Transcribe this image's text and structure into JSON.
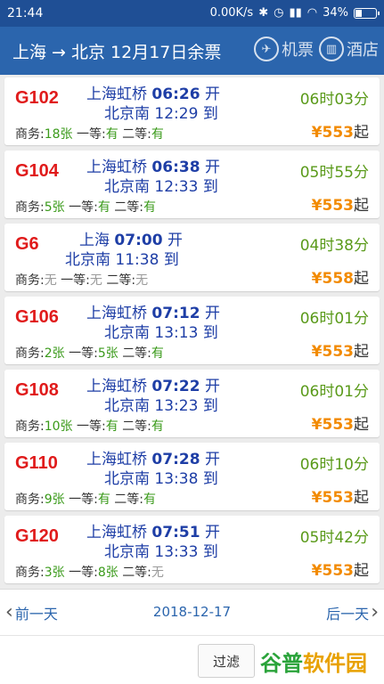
{
  "status_bar": {
    "time": "21:44",
    "network_speed": "0.00K/s",
    "battery_percent": "34%",
    "battery_level": 0.34
  },
  "header": {
    "title": "上海 → 北京 12月17日余票",
    "flight_label": "机票",
    "hotel_label": "酒店"
  },
  "labels": {
    "depart_suffix": "开",
    "arrive_suffix": "到",
    "business_label": "商务:",
    "first_label": "一等:",
    "second_label": "二等:",
    "currency": "¥",
    "price_suffix": "起"
  },
  "trains": [
    {
      "code": "G102",
      "from": "上海虹桥",
      "dep_time": "06:26",
      "to": "北京南",
      "arr_time": "12:29",
      "duration": "06时03分",
      "business": "18张",
      "first": "有",
      "second": "有",
      "price": "553"
    },
    {
      "code": "G104",
      "from": "上海虹桥",
      "dep_time": "06:38",
      "to": "北京南",
      "arr_time": "12:33",
      "duration": "05时55分",
      "business": "5张",
      "first": "有",
      "second": "有",
      "price": "553"
    },
    {
      "code": "G6",
      "from": "上海",
      "dep_time": "07:00",
      "to": "北京南",
      "arr_time": "11:38",
      "duration": "04时38分",
      "business": "无",
      "first": "无",
      "second": "无",
      "price": "558"
    },
    {
      "code": "G106",
      "from": "上海虹桥",
      "dep_time": "07:12",
      "to": "北京南",
      "arr_time": "13:13",
      "duration": "06时01分",
      "business": "2张",
      "first": "5张",
      "second": "有",
      "price": "553"
    },
    {
      "code": "G108",
      "from": "上海虹桥",
      "dep_time": "07:22",
      "to": "北京南",
      "arr_time": "13:23",
      "duration": "06时01分",
      "business": "10张",
      "first": "有",
      "second": "有",
      "price": "553"
    },
    {
      "code": "G110",
      "from": "上海虹桥",
      "dep_time": "07:28",
      "to": "北京南",
      "arr_time": "13:38",
      "duration": "06时10分",
      "business": "9张",
      "first": "有",
      "second": "有",
      "price": "553"
    },
    {
      "code": "G120",
      "from": "上海虹桥",
      "dep_time": "07:51",
      "to": "北京南",
      "arr_time": "13:33",
      "duration": "05时42分",
      "business": "3张",
      "first": "8张",
      "second": "无",
      "price": "553"
    }
  ],
  "date_nav": {
    "prev_label": "前一天",
    "date": "2018-12-17",
    "next_label": "后一天"
  },
  "bottom": {
    "filter_label": "过滤",
    "watermark_part1": "谷普",
    "watermark_part2": "软件园"
  },
  "colors": {
    "header_bg": "#2b65ad",
    "status_bg": "#1f4f95",
    "train_code": "#e01b1b",
    "time_text": "#1e3ea6",
    "duration": "#5a9a1a",
    "price": "#f28a00"
  }
}
